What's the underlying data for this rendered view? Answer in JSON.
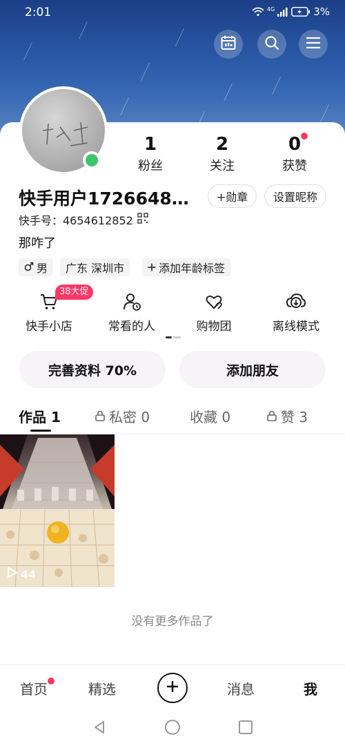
{
  "status_bar": {
    "time": "2:01",
    "battery": "3%",
    "network": "4G"
  },
  "top_actions": [
    "calendar-icon",
    "search-icon",
    "menu-icon"
  ],
  "profile": {
    "stats": [
      {
        "value": "1",
        "label": "粉丝"
      },
      {
        "value": "2",
        "label": "关注"
      },
      {
        "value": "0",
        "label": "获赞"
      }
    ],
    "username": "快手用户1726648…",
    "medal_button": "+勋章",
    "nickname_button": "设置昵称",
    "kuaishou_id": "快手号：4654612852",
    "bio": "那咋了",
    "tags": [
      {
        "text": "男",
        "icon": "male-icon"
      },
      {
        "text": "广东 深圳市",
        "icon": ""
      },
      {
        "text": "添加年龄标签",
        "icon": "plus-icon"
      }
    ]
  },
  "shortcuts": [
    {
      "label": "快手小店",
      "icon": "cart-icon",
      "badge": "38大促"
    },
    {
      "label": "常看的人",
      "icon": "person-clock-icon"
    },
    {
      "label": "购物团",
      "icon": "heart-group-icon"
    },
    {
      "label": "离线模式",
      "icon": "download-cloud-icon"
    }
  ],
  "actions": {
    "complete_profile": "完善资料 70%",
    "add_friends": "添加朋友"
  },
  "tabs": [
    {
      "label": "作品 1",
      "locked": false,
      "active": true
    },
    {
      "label": "私密 0",
      "locked": true,
      "active": false
    },
    {
      "label": "收藏 0",
      "locked": false,
      "active": false
    },
    {
      "label": "赞 3",
      "locked": true,
      "active": false
    }
  ],
  "works": [
    {
      "plays": "44"
    }
  ],
  "no_more_text": "没有更多作品了",
  "bottom_nav": [
    "首页",
    "精选",
    "消息",
    "我"
  ],
  "colors": {
    "accent": "#fe3666",
    "online": "#3ac56b",
    "banner": "#2a5aa8"
  }
}
